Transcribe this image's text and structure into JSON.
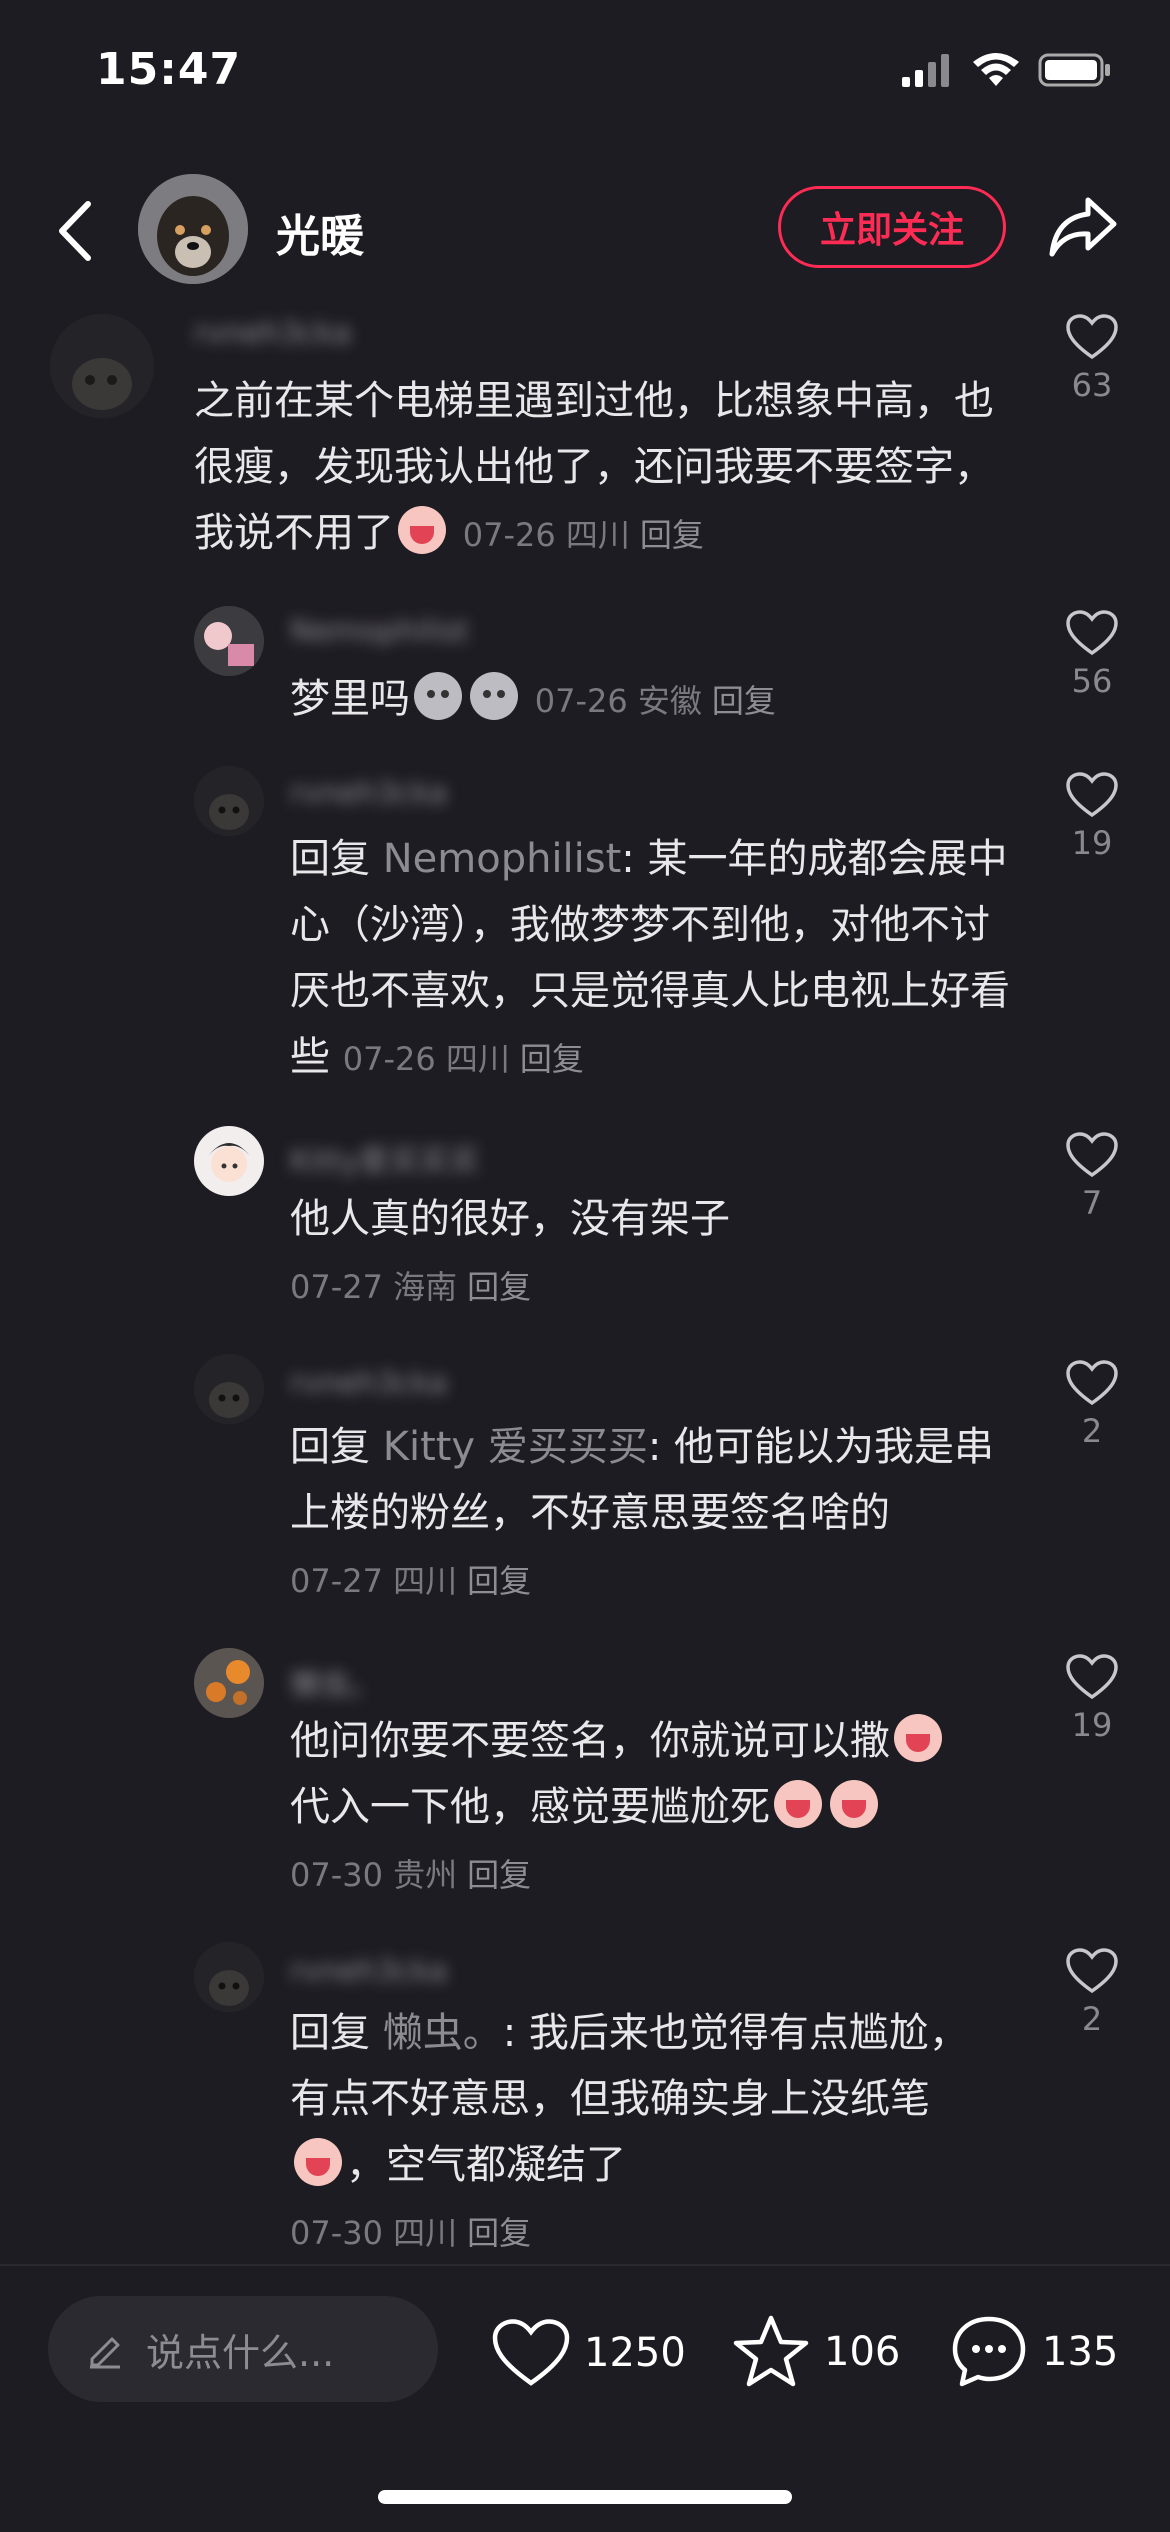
{
  "status_bar": {
    "time": "15:47"
  },
  "header": {
    "author_name": "光暖",
    "follow_label": "立即关注"
  },
  "comments": [
    {
      "username": "rvneh3cka",
      "text": "之前在某个电梯里遇到过他，比想象中高，也很瘦，发现我认出他了，还问我要不要签字，我说不用了",
      "date": "07-26",
      "location": "四川",
      "reply": "回复",
      "likes": "63"
    },
    {
      "username": "Nemophilist",
      "text": "梦里吗",
      "date": "07-26",
      "location": "安徽",
      "reply": "回复",
      "likes": "56"
    },
    {
      "username": "rvneh3cka",
      "reply_prefix": "回复 ",
      "reply_to": "Nemophilist",
      "text": ": 某一年的成都会展中心（沙湾），我做梦梦不到他，对他不讨厌也不喜欢，只是觉得真人比电视上好看些",
      "date": "07-26",
      "location": "四川",
      "reply": "回复",
      "likes": "19"
    },
    {
      "username": "Kitty爱买买买",
      "text": "他人真的很好，没有架子",
      "date": "07-27",
      "location": "海南",
      "reply": "回复",
      "likes": "7"
    },
    {
      "username": "rvneh3cka",
      "reply_prefix": "回复 ",
      "reply_to": "Kitty 爱买买买",
      "text": ": 他可能以为我是串上楼的粉丝，不好意思要签名啥的",
      "date": "07-27",
      "location": "四川",
      "reply": "回复",
      "likes": "2"
    },
    {
      "username": "懒虫。",
      "text_line1": "他问你要不要签名，你就说可以撒",
      "text_line2": "代入一下他，感觉要尴尬死",
      "date": "07-30",
      "location": "贵州",
      "reply": "回复",
      "likes": "19"
    },
    {
      "username": "rvneh3cka",
      "reply_prefix": "回复 ",
      "reply_to": "懒虫。",
      "text_a": ": 我后来也觉得有点尴尬，有点不好意思，但我确实身上没纸笔",
      "text_b": "，空气都凝结了",
      "date": "07-30",
      "location": "四川",
      "reply": "回复",
      "likes": "2"
    }
  ],
  "bottom_bar": {
    "input_placeholder": "说点什么...",
    "like_count": "1250",
    "star_count": "106",
    "comment_count": "135"
  },
  "colors": {
    "background": "#1d1c22",
    "accent": "#fe2c55",
    "muted": "#7a7980"
  }
}
